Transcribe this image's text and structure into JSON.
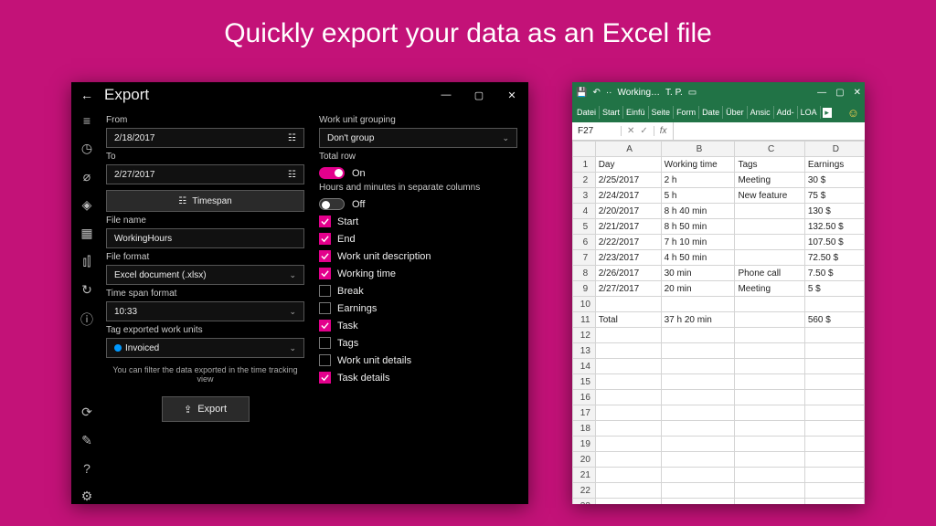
{
  "headline": "Quickly export your data as an Excel file",
  "export": {
    "title": "Export",
    "labels": {
      "from": "From",
      "to": "To",
      "timespan_btn": "Timespan",
      "file_name": "File name",
      "file_format": "File format",
      "timespan_format": "Time span format",
      "tag_exported": "Tag exported work units",
      "filter_hint": "You can filter the data exported in the time tracking view",
      "export_btn": "Export",
      "grouping": "Work unit grouping",
      "total_row": "Total row",
      "on": "On",
      "off": "Off",
      "separate_cols": "Hours and minutes in separate columns"
    },
    "values": {
      "from": "2/18/2017",
      "to": "2/27/2017",
      "file_name": "WorkingHours",
      "file_format": "Excel document (.xlsx)",
      "timespan_format": "10:33",
      "tag": "Invoiced",
      "grouping": "Don't group"
    },
    "checks": [
      {
        "label": "Start",
        "checked": true
      },
      {
        "label": "End",
        "checked": true
      },
      {
        "label": "Work unit description",
        "checked": true
      },
      {
        "label": "Working time",
        "checked": true
      },
      {
        "label": "Break",
        "checked": false
      },
      {
        "label": "Earnings",
        "checked": false
      },
      {
        "label": "Task",
        "checked": true
      },
      {
        "label": "Tags",
        "checked": false
      },
      {
        "label": "Work unit details",
        "checked": false
      },
      {
        "label": "Task details",
        "checked": true
      }
    ]
  },
  "excel": {
    "doc_name": "Working…",
    "user": "T. P.",
    "tabs": [
      "Datei",
      "Start",
      "Einfü",
      "Seite",
      "Form",
      "Date",
      "Über",
      "Ansic",
      "Add-",
      "LOA"
    ],
    "namebox": "F27",
    "fx": "fx",
    "cols": [
      "A",
      "B",
      "C",
      "D"
    ],
    "rows": [
      [
        "Day",
        "Working time",
        "Tags",
        "Earnings"
      ],
      [
        "2/25/2017",
        "2 h",
        "Meeting",
        "30 $"
      ],
      [
        "2/24/2017",
        "5 h",
        "New feature",
        "75 $"
      ],
      [
        "2/20/2017",
        "8 h 40 min",
        "",
        "130 $"
      ],
      [
        "2/21/2017",
        "8 h 50 min",
        "",
        "132.50 $"
      ],
      [
        "2/22/2017",
        "7 h 10 min",
        "",
        "107.50 $"
      ],
      [
        "2/23/2017",
        "4 h 50 min",
        "",
        "72.50 $"
      ],
      [
        "2/26/2017",
        "30 min",
        "Phone call",
        "7.50 $"
      ],
      [
        "2/27/2017",
        "20 min",
        "Meeting",
        "5 $"
      ],
      [
        "",
        "",
        "",
        ""
      ],
      [
        "Total",
        "37 h 20 min",
        "",
        "560 $"
      ]
    ],
    "blank_rows": 13
  }
}
